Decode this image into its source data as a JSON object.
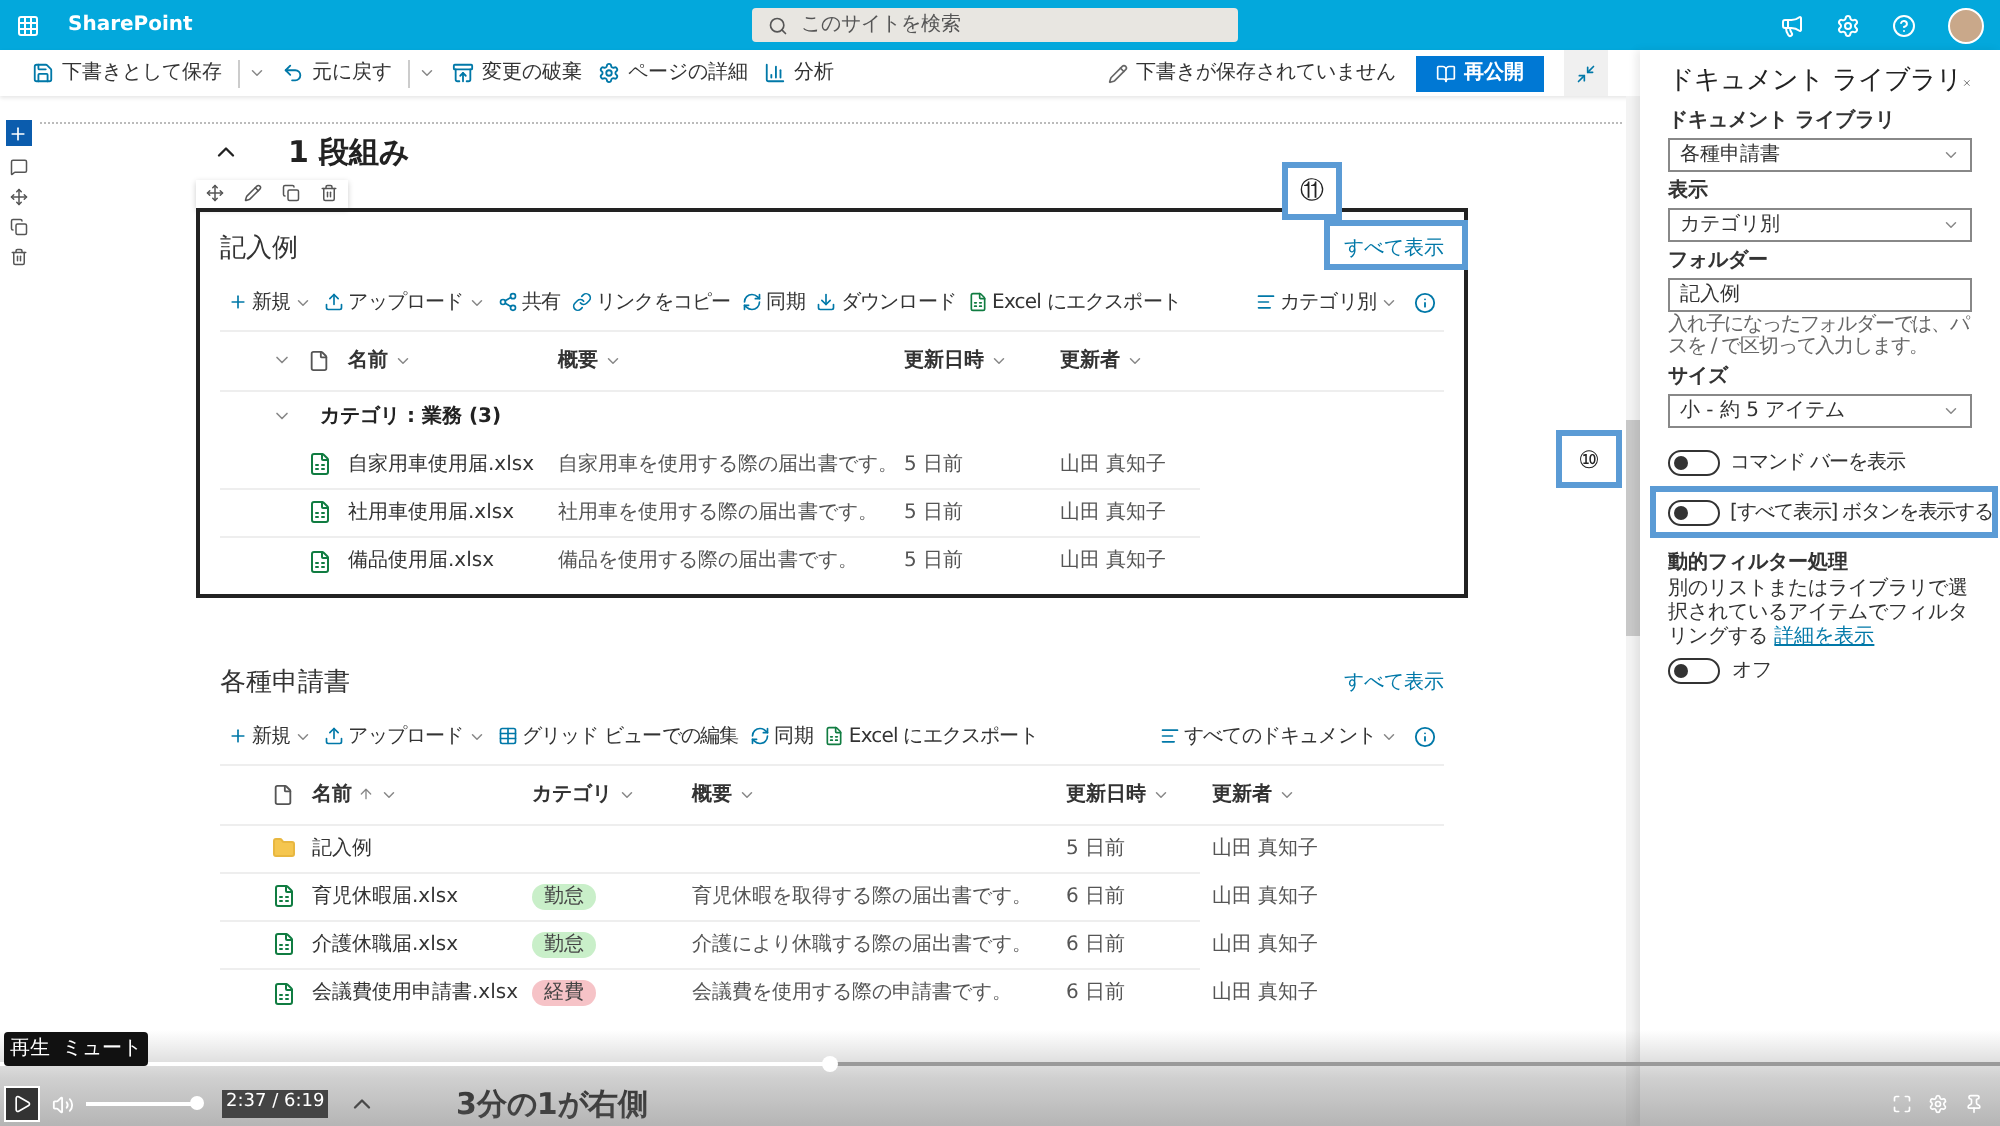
{
  "app_bar": {
    "title": "SharePoint",
    "search": {
      "placeholder": "このサイトを検索"
    }
  },
  "command_bar": {
    "items": [
      {
        "label": "下書きとして保存",
        "kind": "save",
        "dropdown": true
      },
      {
        "label": "元に戻す",
        "kind": "undo",
        "dropdown": true
      },
      {
        "label": "変更の破棄",
        "kind": "discard",
        "dropdown": false
      },
      {
        "label": "ページの詳細",
        "kind": "gear",
        "dropdown": false
      },
      {
        "label": "分析",
        "kind": "chart",
        "dropdown": false
      }
    ],
    "draft_status": "下書きが保存されていません",
    "republish": "再公開"
  },
  "section": {
    "title": "1 段組み"
  },
  "web_parts": [
    {
      "title": "記入例",
      "see_all": "すべて表示",
      "callout": "⑪",
      "selected": true,
      "toolbar": [
        {
          "label": "新規",
          "kind": "plus",
          "dropdown": true
        },
        {
          "label": "アップロード",
          "kind": "upload",
          "dropdown": true
        },
        {
          "label": "共有",
          "kind": "share",
          "dropdown": false
        },
        {
          "label": "リンクをコピー",
          "kind": "link",
          "dropdown": false
        },
        {
          "label": "同期",
          "kind": "sync",
          "dropdown": false
        },
        {
          "label": "ダウンロード",
          "kind": "download",
          "dropdown": false
        },
        {
          "label": "Excel にエクスポート",
          "kind": "excel",
          "dropdown": false
        }
      ],
      "view": "カテゴリ別",
      "columns": [
        {
          "label": "名前",
          "kind": "name",
          "sorted": false
        },
        {
          "label": "概要",
          "kind": "summary",
          "sorted": false
        },
        {
          "label": "更新日時",
          "kind": "modified",
          "sorted": false
        },
        {
          "label": "更新者",
          "kind": "author",
          "sorted": false
        }
      ],
      "group": {
        "label": "カテゴリ : 業務 (3)",
        "expanded": true
      },
      "rows": [
        {
          "kind": "excel",
          "name": "自家用車使用届.xlsx",
          "summary": "自家用車を使用する際の届出書です。",
          "modified": "5 日前",
          "author": "山田 真知子"
        },
        {
          "kind": "excel",
          "name": "社用車使用届.xlsx",
          "summary": "社用車を使用する際の届出書です。",
          "modified": "5 日前",
          "author": "山田 真知子"
        },
        {
          "kind": "excel",
          "name": "備品使用届.xlsx",
          "summary": "備品を使用する際の届出書です。",
          "modified": "5 日前",
          "author": "山田 真知子"
        }
      ]
    },
    {
      "title": "各種申請書",
      "see_all": "すべて表示",
      "selected": false,
      "toolbar": [
        {
          "label": "新規",
          "kind": "plus",
          "dropdown": true
        },
        {
          "label": "アップロード",
          "kind": "upload",
          "dropdown": true
        },
        {
          "label": "グリッド ビューでの編集",
          "kind": "grid",
          "dropdown": false
        },
        {
          "label": "同期",
          "kind": "sync",
          "dropdown": false
        },
        {
          "label": "Excel にエクスポート",
          "kind": "excel",
          "dropdown": false
        }
      ],
      "view": "すべてのドキュメント",
      "columns": [
        {
          "label": "名前",
          "kind": "name",
          "sorted": true
        },
        {
          "label": "カテゴリ",
          "kind": "category",
          "sorted": false
        },
        {
          "label": "概要",
          "kind": "summary",
          "sorted": false
        },
        {
          "label": "更新日時",
          "kind": "modified",
          "sorted": false
        },
        {
          "label": "更新者",
          "kind": "author",
          "sorted": false
        }
      ],
      "rows": [
        {
          "kind": "folder",
          "name": "記入例",
          "modified": "5 日前",
          "author": "山田 真知子"
        },
        {
          "kind": "excel",
          "name": "育児休暇届.xlsx",
          "category": {
            "label": "勤怠",
            "color": "#c9efc9"
          },
          "summary": "育児休暇を取得する際の届出書です。",
          "modified": "6 日前",
          "author": "山田 真知子"
        },
        {
          "kind": "excel",
          "name": "介護休職届.xlsx",
          "category": {
            "label": "勤怠",
            "color": "#c9efc9"
          },
          "summary": "介護により休職する際の届出書です。",
          "modified": "6 日前",
          "author": "山田 真知子"
        },
        {
          "kind": "excel",
          "name": "会議費使用申請書.xlsx",
          "category": {
            "label": "経費",
            "color": "#f6c3c7"
          },
          "summary": "会議費を使用する際の申請書です。",
          "modified": "6 日前",
          "author": "山田 真知子"
        }
      ]
    }
  ],
  "next_section": {
    "title": "3分の1が右側"
  },
  "property_pane": {
    "title": "ドキュメント ライブラリ",
    "fields": [
      {
        "kind": "select",
        "label": "ドキュメント ライブラリ",
        "value": "各種申請書"
      },
      {
        "kind": "select",
        "label": "表示",
        "value": "カテゴリ別"
      },
      {
        "kind": "text",
        "label": "フォルダー",
        "value": "記入例",
        "hint": "入れ子になったフォルダーでは、パスを / で区切って入力します。"
      },
      {
        "kind": "select",
        "label": "サイズ",
        "value": "小 - 約 5 アイテム"
      },
      {
        "kind": "toggle",
        "label": "コマンド バーを表示",
        "on": false
      },
      {
        "kind": "toggle",
        "label": "[すべて表示] ボタンを表示する",
        "on": false,
        "callout": "⑩"
      },
      {
        "kind": "filter",
        "label": "動的フィルター処理",
        "description": "別のリストまたはライブラリで選択されているアイテムでフィルタリングする",
        "link": "詳細を表示",
        "on": false,
        "state": "オフ"
      }
    ]
  },
  "video": {
    "tooltips": [
      "再生",
      "ミュート"
    ],
    "time": "2:37 / 6:19",
    "progress": {
      "level": 0.415
    },
    "volume": {
      "level": 1
    }
  }
}
